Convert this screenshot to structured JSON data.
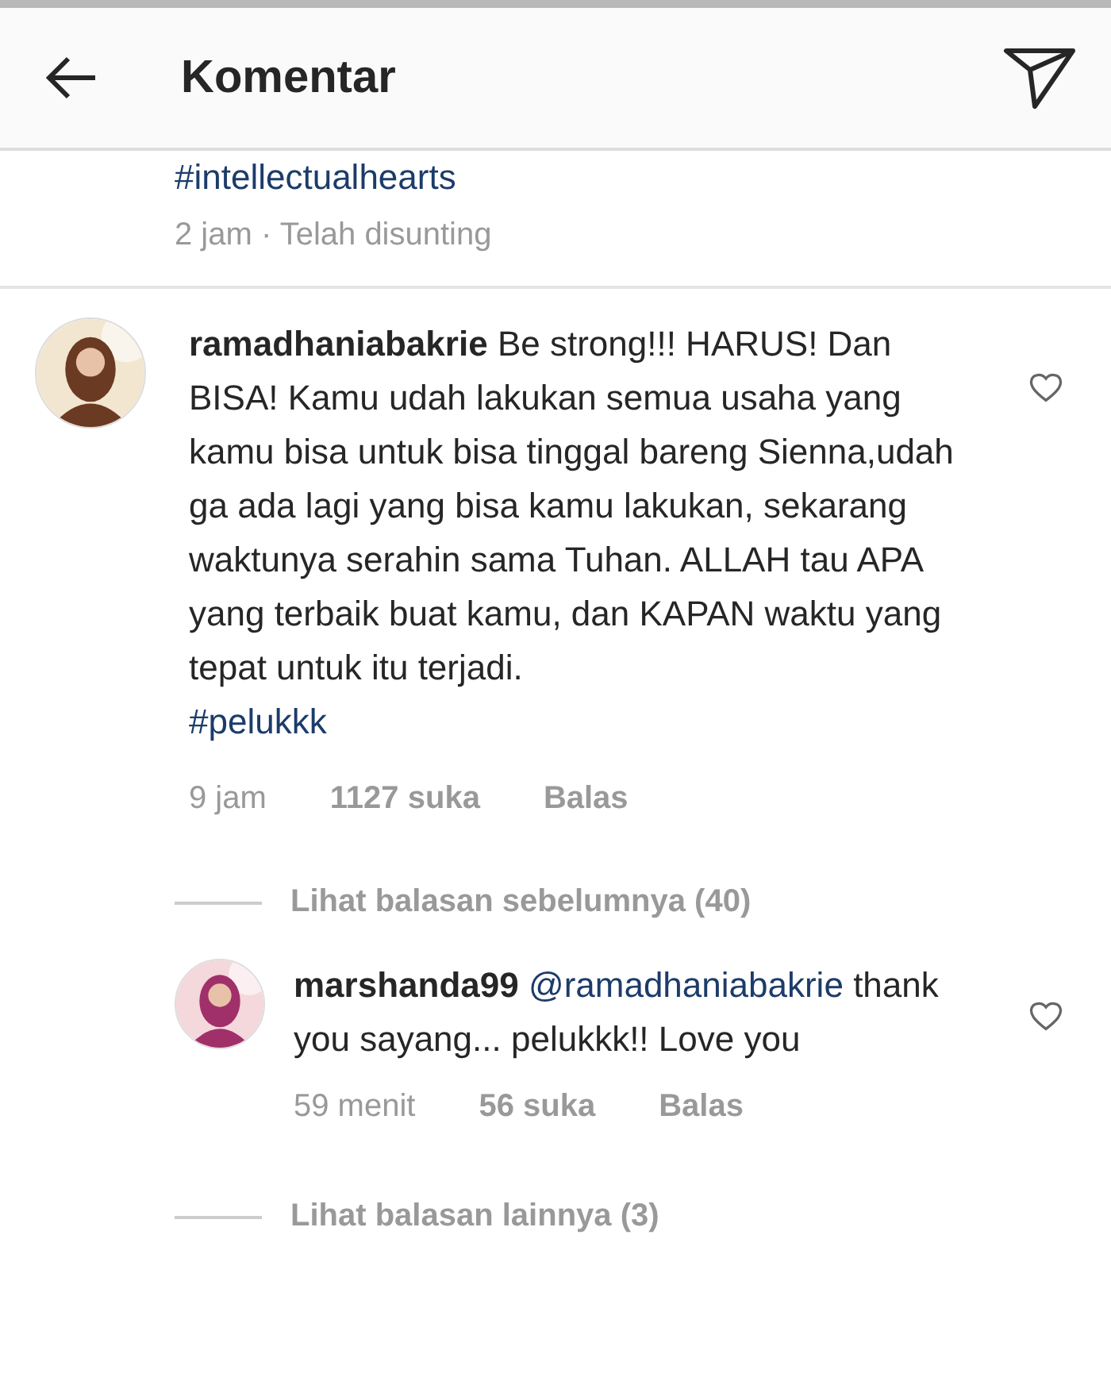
{
  "header": {
    "title": "Komentar"
  },
  "caption": {
    "hashtag": "#intellectualhearts",
    "meta": "2 jam · Telah disunting"
  },
  "comments": [
    {
      "username": "ramadhaniabakrie",
      "text": "Be strong!!! HARUS! Dan BISA! Kamu udah lakukan semua usaha yang kamu bisa untuk bisa tinggal bareng Sienna,udah ga ada lagi yang bisa kamu lakukan, sekarang waktunya serahin sama Tuhan. ALLAH tau APA yang terbaik buat kamu, dan KAPAN waktu yang tepat untuk itu terjadi.",
      "hashtag": "#pelukkk",
      "time": "9 jam",
      "likes": "1127 suka",
      "reply": "Balas",
      "liked": false,
      "view_previous": "Lihat balasan sebelumnya (40)",
      "view_more": "Lihat balasan lainnya (3)",
      "replies": [
        {
          "username": "marshanda99",
          "mention": "@ramadhaniabakrie",
          "text": "thank you sayang... pelukkk!! Love you",
          "time": "59 menit",
          "likes": "56 suka",
          "reply": "Balas",
          "liked": false
        }
      ]
    }
  ]
}
